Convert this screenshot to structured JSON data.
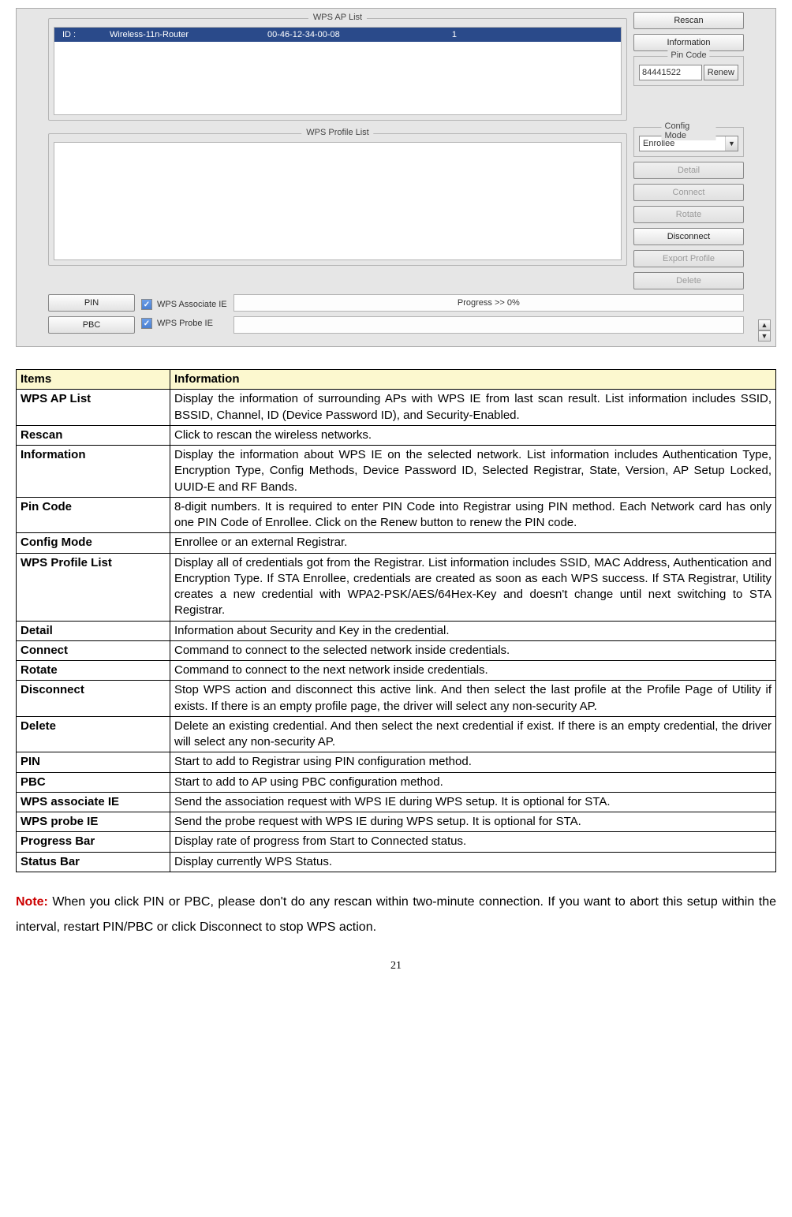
{
  "wps": {
    "ap_list": {
      "legend": "WPS AP List",
      "row": {
        "id_lbl": "ID :",
        "ssid": "Wireless-11n-Router",
        "bssid": "00-46-12-34-00-08",
        "ch": "1"
      }
    },
    "side": {
      "rescan": "Rescan",
      "information": "Information",
      "pin_legend": "Pin Code",
      "pin_value": "84441522",
      "renew": "Renew",
      "config_legend": "Config Mode",
      "config_value": "Enrollee",
      "detail": "Detail",
      "connect": "Connect",
      "rotate": "Rotate",
      "disconnect": "Disconnect",
      "export": "Export Profile",
      "delete": "Delete"
    },
    "profile_legend": "WPS Profile List",
    "bottom": {
      "pin": "PIN",
      "pbc": "PBC",
      "assoc": "WPS Associate IE",
      "probe": "WPS Probe IE",
      "progress": "Progress >> 0%"
    }
  },
  "table": {
    "head_items": "Items",
    "head_info": "Information",
    "rows": [
      {
        "k": "WPS AP List",
        "v": "Display the information of surrounding APs with WPS IE from last scan result. List information includes SSID, BSSID, Channel, ID (Device Password ID), and Security-Enabled."
      },
      {
        "k": "Rescan",
        "v": "Click to rescan the wireless networks."
      },
      {
        "k": "Information",
        "v": "Display the information about WPS IE on the selected network. List information includes Authentication Type, Encryption Type, Config Methods, Device Password ID, Selected Registrar, State, Version, AP Setup Locked, UUID-E and RF Bands."
      },
      {
        "k": "Pin Code",
        "v": "8-digit numbers. It is required to enter PIN Code into Registrar using PIN method. Each Network card has only one PIN Code of Enrollee. Click on the Renew button to renew the PIN code."
      },
      {
        "k": "Config Mode",
        "v": "Enrollee or an external Registrar."
      },
      {
        "k": "WPS Profile List",
        "v": "Display all of credentials got from the Registrar. List information includes SSID, MAC Address, Authentication and Encryption Type. If STA Enrollee, credentials are created as soon as each WPS success. If STA Registrar, Utility creates a new credential with WPA2-PSK/AES/64Hex-Key and doesn't change until next switching to STA Registrar."
      },
      {
        "k": "Detail",
        "v": "Information about Security and Key in the credential."
      },
      {
        "k": "Connect",
        "v": "Command to connect to the selected network inside credentials."
      },
      {
        "k": "Rotate",
        "v": "Command to connect to the next network inside credentials."
      },
      {
        "k": "Disconnect",
        "v": "Stop WPS action and disconnect this active link. And then select the last profile at the Profile Page of Utility if exists. If there is an empty profile page, the driver will select any non-security AP."
      },
      {
        "k": "Delete",
        "v": "Delete an existing credential. And then select the next credential if exist. If there is an empty credential, the driver will select any non-security AP."
      },
      {
        "k": "PIN",
        "v": "Start to add to Registrar using PIN configuration method."
      },
      {
        "k": "PBC",
        "v": "Start to add to AP using PBC configuration method."
      },
      {
        "k": "WPS associate IE",
        "v": "Send the association request with WPS IE during WPS setup. It is optional for STA."
      },
      {
        "k": "WPS probe IE",
        "v": "Send the probe request with WPS IE during WPS setup. It is optional for STA."
      },
      {
        "k": "Progress Bar",
        "v": "Display rate of progress from Start to Connected status."
      },
      {
        "k": "Status Bar",
        "v": "Display currently WPS Status."
      }
    ]
  },
  "note": {
    "label": "Note:",
    "text": " When you click PIN or PBC, please don't do any rescan within two-minute connection. If you want to abort this setup within the interval, restart PIN/PBC or click Disconnect to stop WPS action."
  },
  "page_number": "21"
}
